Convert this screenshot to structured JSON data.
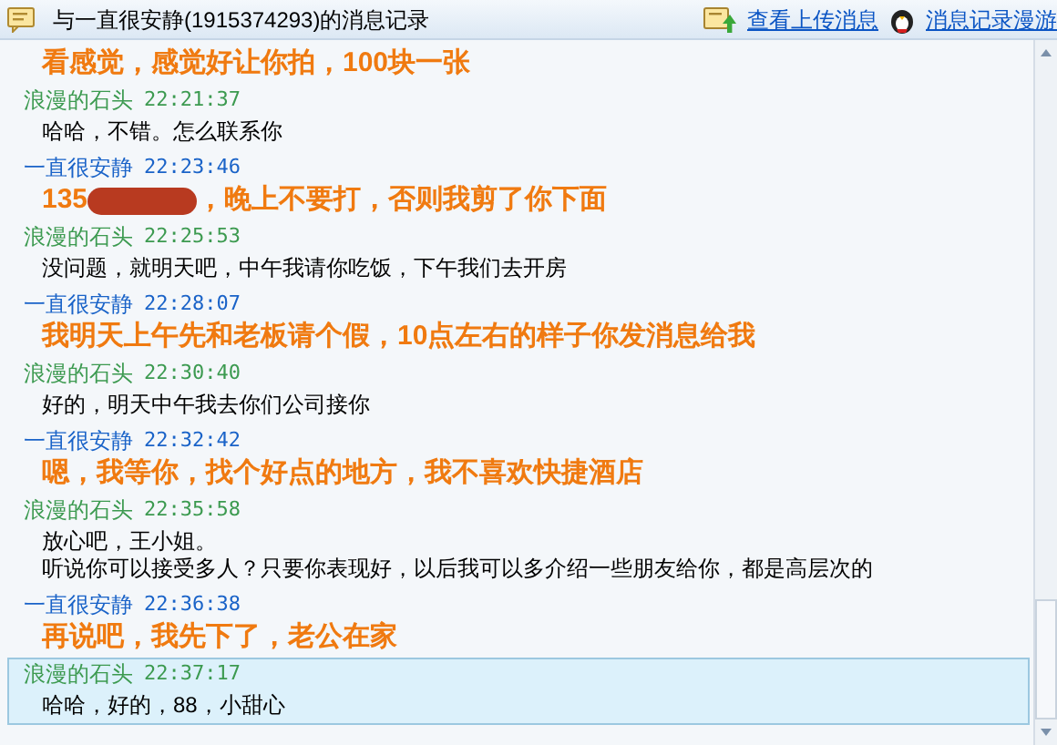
{
  "window": {
    "title": "与一直很安静(1915374293)的消息记录"
  },
  "toolbar_links": [
    {
      "label": "查看上传消息",
      "kind": "upload"
    },
    {
      "label": "消息记录漫游",
      "kind": "roam"
    }
  ],
  "messages": [
    {
      "kind": "contact",
      "parts": [
        {
          "text": "看感觉，感觉好让你拍，100块一张"
        }
      ],
      "selected": false
    },
    {
      "sender": "浪漫的石头",
      "time": "22:21:37",
      "kind": "self",
      "parts": [
        {
          "text": "哈哈，不错。怎么联系你"
        }
      ],
      "selected": false
    },
    {
      "sender": "一直很安静",
      "time": "22:23:46",
      "kind": "contact",
      "parts": [
        {
          "text": "135"
        },
        {
          "kind": "redaction"
        },
        {
          "text": "，晚上不要打，否则我剪了你下面"
        }
      ],
      "selected": false
    },
    {
      "sender": "浪漫的石头",
      "time": "22:25:53",
      "kind": "self",
      "parts": [
        {
          "text": "没问题，就明天吧，中午我请你吃饭，下午我们去开房"
        }
      ],
      "selected": false
    },
    {
      "sender": "一直很安静",
      "time": "22:28:07",
      "kind": "contact",
      "parts": [
        {
          "text": "我明天上午先和老板请个假，10点左右的样子你发消息给我"
        }
      ],
      "selected": false
    },
    {
      "sender": "浪漫的石头",
      "time": "22:30:40",
      "kind": "self",
      "parts": [
        {
          "text": "好的，明天中午我去你们公司接你"
        }
      ],
      "selected": false
    },
    {
      "sender": "一直很安静",
      "time": "22:32:42",
      "kind": "contact",
      "parts": [
        {
          "text": "嗯，我等你，找个好点的地方，我不喜欢快捷酒店"
        }
      ],
      "selected": false
    },
    {
      "sender": "浪漫的石头",
      "time": "22:35:58",
      "kind": "self",
      "parts": [
        {
          "text": "放心吧，王小姐。"
        },
        {
          "kind": "break"
        },
        {
          "text": "听说你可以接受多人？只要你表现好，以后我可以多介绍一些朋友给你，都是高层次的"
        }
      ],
      "selected": false
    },
    {
      "sender": "一直很安静",
      "time": "22:36:38",
      "kind": "contact",
      "parts": [
        {
          "text": "再说吧，我先下了，老公在家"
        }
      ],
      "selected": false
    },
    {
      "sender": "浪漫的石头",
      "time": "22:37:17",
      "kind": "self",
      "parts": [
        {
          "text": "哈哈，好的，88，小甜心"
        }
      ],
      "selected": true
    }
  ]
}
